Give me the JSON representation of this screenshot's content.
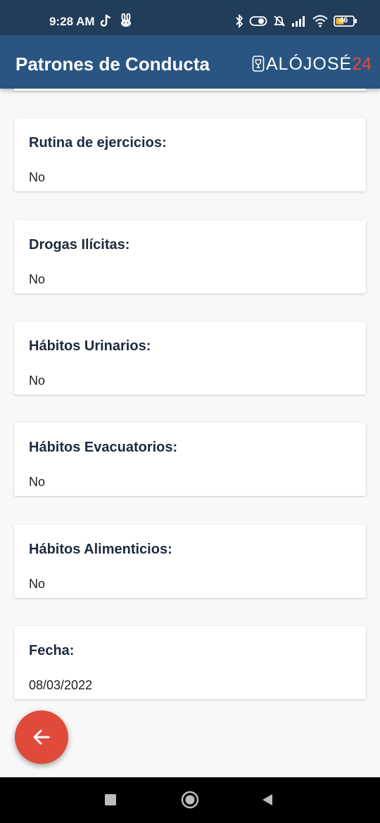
{
  "status_bar": {
    "time": "9:28 AM",
    "battery_level": "46",
    "icons_left": [
      "tiktok-icon",
      "bunny-icon"
    ],
    "icons_right": [
      "bluetooth-icon",
      "toggle-icon",
      "mute-alarm-icon",
      "signal-icon",
      "wifi-icon",
      "battery-icon"
    ]
  },
  "app_bar": {
    "title": "Patrones de Conducta",
    "brand_main": "ALÓJOSÉ",
    "brand_number": "24"
  },
  "cards": [
    {
      "label": "Rutina de ejercicios:",
      "value": "No"
    },
    {
      "label": "Drogas Ilícitas:",
      "value": "No"
    },
    {
      "label": "Hábitos Urinarios:",
      "value": "No"
    },
    {
      "label": "Hábitos Evacuatorios:",
      "value": "No"
    },
    {
      "label": "Hábitos Alimenticios:",
      "value": "No"
    },
    {
      "label": "Fecha:",
      "value": "08/03/2022"
    }
  ],
  "fab": {
    "icon": "arrow-left-icon"
  },
  "colors": {
    "status_bar": "#223d5a",
    "app_bar": "#2a5582",
    "accent": "#e04a3b",
    "background": "#f8f8f8"
  },
  "nav_bar": {
    "icons": [
      "square-icon",
      "circle-icon",
      "back-triangle-icon"
    ]
  }
}
